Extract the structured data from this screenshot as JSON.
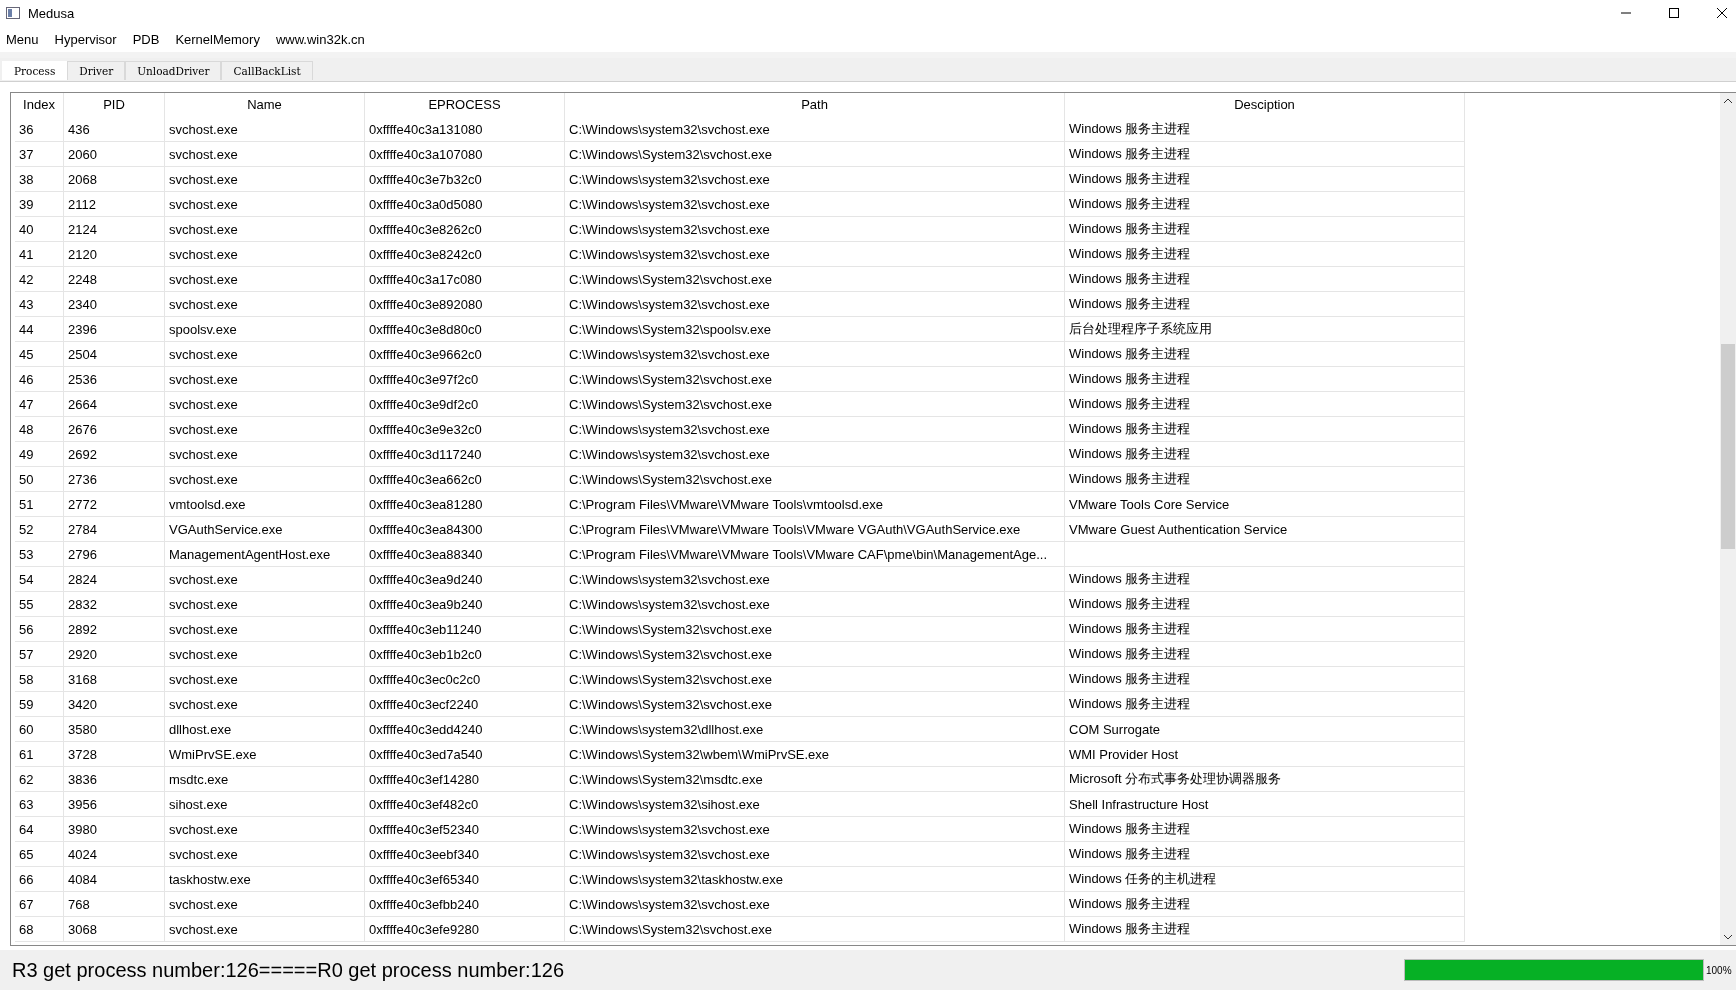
{
  "window": {
    "title": "Medusa"
  },
  "menu": [
    "Menu",
    "Hypervisor",
    "PDB",
    "KernelMemory",
    "www.win32k.cn"
  ],
  "tabs": [
    {
      "label": "Process",
      "selected": true
    },
    {
      "label": "Driver",
      "selected": false
    },
    {
      "label": "UnloadDriver",
      "selected": false
    },
    {
      "label": "CallBackList",
      "selected": false
    }
  ],
  "table": {
    "columns": [
      "Index",
      "PID",
      "Name",
      "EPROCESS",
      "Path",
      "Desciption"
    ],
    "rows": [
      {
        "index": "36",
        "pid": "436",
        "name": "svchost.exe",
        "eprocess": "0xffffe40c3a131080",
        "path": "C:\\Windows\\system32\\svchost.exe",
        "description": "Windows 服务主进程"
      },
      {
        "index": "37",
        "pid": "2060",
        "name": "svchost.exe",
        "eprocess": "0xffffe40c3a107080",
        "path": "C:\\Windows\\System32\\svchost.exe",
        "description": "Windows 服务主进程"
      },
      {
        "index": "38",
        "pid": "2068",
        "name": "svchost.exe",
        "eprocess": "0xffffe40c3e7b32c0",
        "path": "C:\\Windows\\system32\\svchost.exe",
        "description": "Windows 服务主进程"
      },
      {
        "index": "39",
        "pid": "2112",
        "name": "svchost.exe",
        "eprocess": "0xffffe40c3a0d5080",
        "path": "C:\\Windows\\system32\\svchost.exe",
        "description": "Windows 服务主进程"
      },
      {
        "index": "40",
        "pid": "2124",
        "name": "svchost.exe",
        "eprocess": "0xffffe40c3e8262c0",
        "path": "C:\\Windows\\system32\\svchost.exe",
        "description": "Windows 服务主进程"
      },
      {
        "index": "41",
        "pid": "2120",
        "name": "svchost.exe",
        "eprocess": "0xffffe40c3e8242c0",
        "path": "C:\\Windows\\system32\\svchost.exe",
        "description": "Windows 服务主进程"
      },
      {
        "index": "42",
        "pid": "2248",
        "name": "svchost.exe",
        "eprocess": "0xffffe40c3a17c080",
        "path": "C:\\Windows\\System32\\svchost.exe",
        "description": "Windows 服务主进程"
      },
      {
        "index": "43",
        "pid": "2340",
        "name": "svchost.exe",
        "eprocess": "0xffffe40c3e892080",
        "path": "C:\\Windows\\system32\\svchost.exe",
        "description": "Windows 服务主进程"
      },
      {
        "index": "44",
        "pid": "2396",
        "name": "spoolsv.exe",
        "eprocess": "0xffffe40c3e8d80c0",
        "path": "C:\\Windows\\System32\\spoolsv.exe",
        "description": "后台处理程序子系统应用"
      },
      {
        "index": "45",
        "pid": "2504",
        "name": "svchost.exe",
        "eprocess": "0xffffe40c3e9662c0",
        "path": "C:\\Windows\\system32\\svchost.exe",
        "description": "Windows 服务主进程"
      },
      {
        "index": "46",
        "pid": "2536",
        "name": "svchost.exe",
        "eprocess": "0xffffe40c3e97f2c0",
        "path": "C:\\Windows\\System32\\svchost.exe",
        "description": "Windows 服务主进程"
      },
      {
        "index": "47",
        "pid": "2664",
        "name": "svchost.exe",
        "eprocess": "0xffffe40c3e9df2c0",
        "path": "C:\\Windows\\System32\\svchost.exe",
        "description": "Windows 服务主进程"
      },
      {
        "index": "48",
        "pid": "2676",
        "name": "svchost.exe",
        "eprocess": "0xffffe40c3e9e32c0",
        "path": "C:\\Windows\\system32\\svchost.exe",
        "description": "Windows 服务主进程"
      },
      {
        "index": "49",
        "pid": "2692",
        "name": "svchost.exe",
        "eprocess": "0xffffe40c3d117240",
        "path": "C:\\Windows\\system32\\svchost.exe",
        "description": "Windows 服务主进程"
      },
      {
        "index": "50",
        "pid": "2736",
        "name": "svchost.exe",
        "eprocess": "0xffffe40c3ea662c0",
        "path": "C:\\Windows\\System32\\svchost.exe",
        "description": "Windows 服务主进程"
      },
      {
        "index": "51",
        "pid": "2772",
        "name": "vmtoolsd.exe",
        "eprocess": "0xffffe40c3ea81280",
        "path": "C:\\Program Files\\VMware\\VMware Tools\\vmtoolsd.exe",
        "description": "VMware Tools Core Service"
      },
      {
        "index": "52",
        "pid": "2784",
        "name": "VGAuthService.exe",
        "eprocess": "0xffffe40c3ea84300",
        "path": "C:\\Program Files\\VMware\\VMware Tools\\VMware VGAuth\\VGAuthService.exe",
        "description": "VMware Guest Authentication Service"
      },
      {
        "index": "53",
        "pid": "2796",
        "name": "ManagementAgentHost.exe",
        "eprocess": "0xffffe40c3ea88340",
        "path": "C:\\Program Files\\VMware\\VMware Tools\\VMware CAF\\pme\\bin\\ManagementAge..."
      },
      {
        "index": "54",
        "pid": "2824",
        "name": "svchost.exe",
        "eprocess": "0xffffe40c3ea9d240",
        "path": "C:\\Windows\\system32\\svchost.exe",
        "description": "Windows 服务主进程"
      },
      {
        "index": "55",
        "pid": "2832",
        "name": "svchost.exe",
        "eprocess": "0xffffe40c3ea9b240",
        "path": "C:\\Windows\\system32\\svchost.exe",
        "description": "Windows 服务主进程"
      },
      {
        "index": "56",
        "pid": "2892",
        "name": "svchost.exe",
        "eprocess": "0xffffe40c3eb11240",
        "path": "C:\\Windows\\System32\\svchost.exe",
        "description": "Windows 服务主进程"
      },
      {
        "index": "57",
        "pid": "2920",
        "name": "svchost.exe",
        "eprocess": "0xffffe40c3eb1b2c0",
        "path": "C:\\Windows\\System32\\svchost.exe",
        "description": "Windows 服务主进程"
      },
      {
        "index": "58",
        "pid": "3168",
        "name": "svchost.exe",
        "eprocess": "0xffffe40c3ec0c2c0",
        "path": "C:\\Windows\\System32\\svchost.exe",
        "description": "Windows 服务主进程"
      },
      {
        "index": "59",
        "pid": "3420",
        "name": "svchost.exe",
        "eprocess": "0xffffe40c3ecf2240",
        "path": "C:\\Windows\\System32\\svchost.exe",
        "description": "Windows 服务主进程"
      },
      {
        "index": "60",
        "pid": "3580",
        "name": "dllhost.exe",
        "eprocess": "0xffffe40c3edd4240",
        "path": "C:\\Windows\\system32\\dllhost.exe",
        "description": "COM Surrogate"
      },
      {
        "index": "61",
        "pid": "3728",
        "name": "WmiPrvSE.exe",
        "eprocess": "0xffffe40c3ed7a540",
        "path": "C:\\Windows\\System32\\wbem\\WmiPrvSE.exe",
        "description": "WMI Provider Host"
      },
      {
        "index": "62",
        "pid": "3836",
        "name": "msdtc.exe",
        "eprocess": "0xffffe40c3ef14280",
        "path": "C:\\Windows\\System32\\msdtc.exe",
        "description": "Microsoft 分布式事务处理协调器服务"
      },
      {
        "index": "63",
        "pid": "3956",
        "name": "sihost.exe",
        "eprocess": "0xffffe40c3ef482c0",
        "path": "C:\\Windows\\system32\\sihost.exe",
        "description": "Shell Infrastructure Host"
      },
      {
        "index": "64",
        "pid": "3980",
        "name": "svchost.exe",
        "eprocess": "0xffffe40c3ef52340",
        "path": "C:\\Windows\\system32\\svchost.exe",
        "description": "Windows 服务主进程"
      },
      {
        "index": "65",
        "pid": "4024",
        "name": "svchost.exe",
        "eprocess": "0xffffe40c3eebf340",
        "path": "C:\\Windows\\system32\\svchost.exe",
        "description": "Windows 服务主进程"
      },
      {
        "index": "66",
        "pid": "4084",
        "name": "taskhostw.exe",
        "eprocess": "0xffffe40c3ef65340",
        "path": "C:\\Windows\\system32\\taskhostw.exe",
        "description": "Windows 任务的主机进程"
      },
      {
        "index": "67",
        "pid": "768",
        "name": "svchost.exe",
        "eprocess": "0xffffe40c3efbb240",
        "path": "C:\\Windows\\system32\\svchost.exe",
        "description": "Windows 服务主进程"
      },
      {
        "index": "68",
        "pid": "3068",
        "name": "svchost.exe",
        "eprocess": "0xffffe40c3efe9280",
        "path": "C:\\Windows\\System32\\svchost.exe",
        "description": "Windows 服务主进程"
      }
    ]
  },
  "status_bar": {
    "message": "R3 get process number:126=====R0 get process number:126",
    "progress": {
      "level": 1,
      "reading": "100%"
    }
  }
}
